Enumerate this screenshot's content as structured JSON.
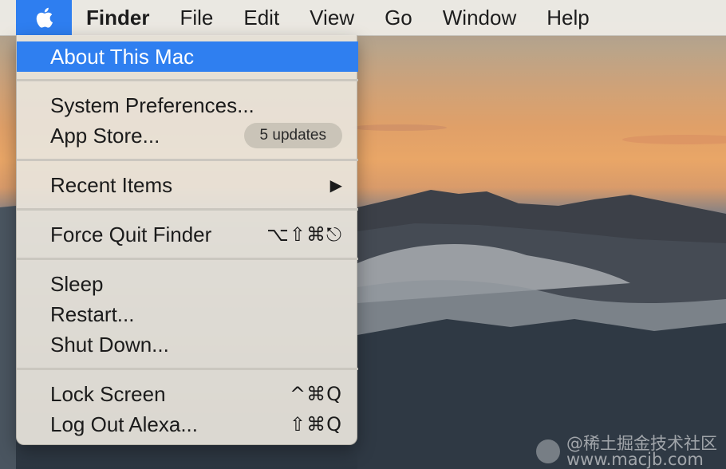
{
  "menubar": {
    "apple_icon": "apple-logo-icon",
    "app_name": "Finder",
    "items": [
      "File",
      "Edit",
      "View",
      "Go",
      "Window",
      "Help"
    ],
    "accent_color": "#2e7ef0"
  },
  "apple_menu": {
    "about": "About This Mac",
    "system_preferences": "System Preferences...",
    "app_store": "App Store...",
    "app_store_badge": "5 updates",
    "recent_items": "Recent Items",
    "recent_items_arrow": "▶",
    "force_quit": "Force Quit Finder",
    "force_quit_shortcut": "⌥⇧⌘⎋",
    "sleep": "Sleep",
    "restart": "Restart...",
    "shut_down": "Shut Down...",
    "lock_screen": "Lock Screen",
    "lock_screen_shortcut": "^⌘Q",
    "log_out": "Log Out Alexa...",
    "log_out_shortcut": "⇧⌘Q"
  },
  "watermark": {
    "line1": "@稀土掘金技术社区",
    "line2": "www.macjb.com"
  }
}
